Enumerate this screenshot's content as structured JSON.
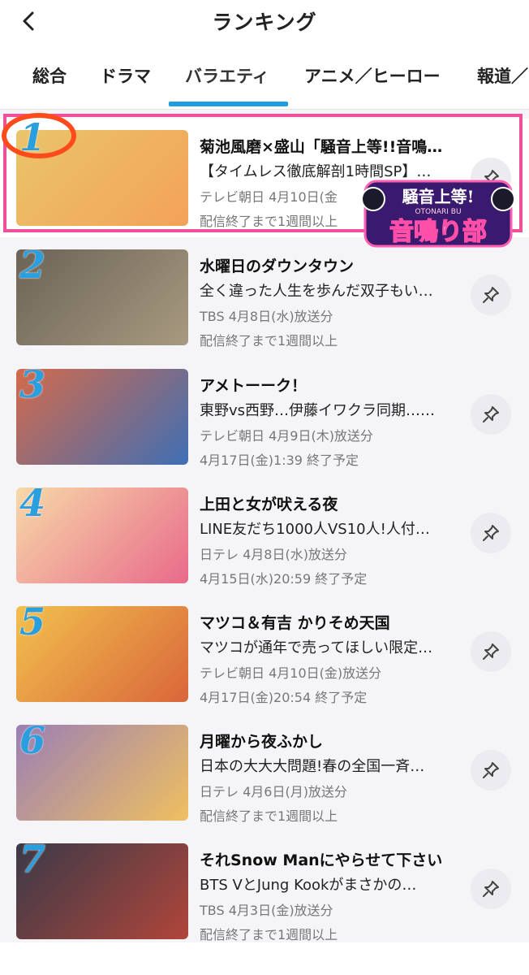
{
  "header": {
    "title": "ランキング"
  },
  "tabs": [
    "総合",
    "ドラマ",
    "バラエティ",
    "アニメ／ヒーロー",
    "報道／"
  ],
  "items": [
    {
      "rank": "1",
      "title": "菊池風磨×盛山「騒音上等!!音鳴…",
      "subtitle": "【タイムレス徹底解剖1時間SP】…",
      "broadcast": "テレビ朝日 4月10日(金",
      "availability": "配信終了まで1週間以上",
      "thumb_colors": [
        "#e9c46a",
        "#f4a259"
      ]
    },
    {
      "rank": "2",
      "title": "水曜日のダウンタウン",
      "subtitle": "全く違った人生を歩んだ双子もい…",
      "broadcast": "TBS 4月8日(水)放送分",
      "availability": "配信終了まで1週間以上",
      "thumb_colors": [
        "#6b6356",
        "#a89a80"
      ]
    },
    {
      "rank": "3",
      "title": "アメトーーク！",
      "subtitle": "東野vs西野…伊藤イワクラ同期……",
      "broadcast": "テレビ朝日 4月9日(木)放送分",
      "availability": "4月17日(金)1:39 終了予定",
      "thumb_colors": [
        "#d46a4a",
        "#3f6fb5"
      ]
    },
    {
      "rank": "4",
      "title": "上田と女が吠える夜",
      "subtitle": "LINE友だち1000人VS10人!人付…",
      "broadcast": "日テレ 4月8日(水)放送分",
      "availability": "4月15日(水)20:59 終了予定",
      "thumb_colors": [
        "#f7d9a8",
        "#e86a8a"
      ]
    },
    {
      "rank": "5",
      "title": "マツコ＆有吉 かりそめ天国",
      "subtitle": "マツコが通年で売ってほしい限定…",
      "broadcast": "テレビ朝日 4月10日(金)放送分",
      "availability": "4月17日(金)20:54 終了予定",
      "thumb_colors": [
        "#f2c14e",
        "#d9663a"
      ]
    },
    {
      "rank": "6",
      "title": "月曜から夜ふかし",
      "subtitle": "日本の大大大問題!春の全国一斉…",
      "broadcast": "日テレ 4月6日(月)放送分",
      "availability": "配信終了まで1週間以上",
      "thumb_colors": [
        "#9a7fb5",
        "#f0c060"
      ]
    },
    {
      "rank": "7",
      "title": "それSnow Manにやらせて下さい",
      "subtitle": "BTS VとJung Kookがまさかの…",
      "broadcast": "TBS 4月3日(金)放送分",
      "availability": "配信終了まで1週間以上",
      "thumb_colors": [
        "#3a3a48",
        "#b0453a"
      ]
    }
  ],
  "overlay": {
    "logo_top": "騒音上等!",
    "logo_sub": "OTONARI BU",
    "logo_main": "音鳴り部"
  },
  "colors": {
    "accent": "#1c9ee0",
    "highlight_border": "#f0509a",
    "rank_circle": "#ff4a1c"
  }
}
